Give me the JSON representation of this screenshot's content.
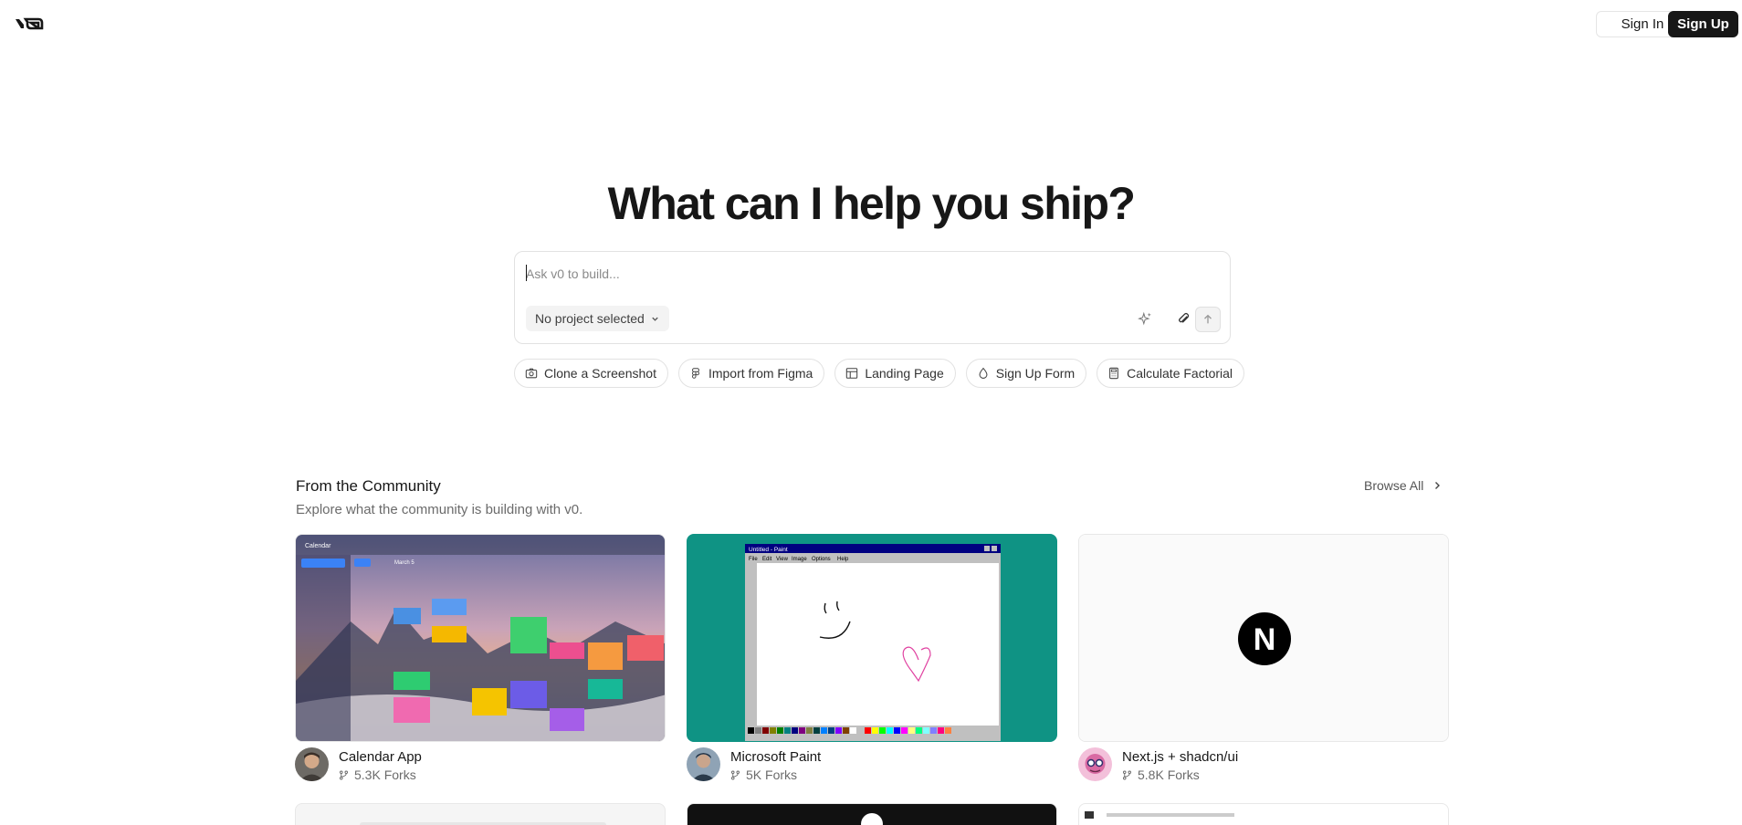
{
  "header": {
    "logo_icon": "v0-logo-icon",
    "signin_label": "Sign In",
    "signup_label": "Sign Up"
  },
  "hero": {
    "title": "What can I help you ship?"
  },
  "prompt": {
    "placeholder": "Ask v0 to build...",
    "project_select_label": "No project selected",
    "icons": [
      "sparkle-icon",
      "paperclip-icon",
      "arrow-up-icon"
    ]
  },
  "suggestions": [
    {
      "label": "Clone a Screenshot",
      "icon": "camera-icon"
    },
    {
      "label": "Import from Figma",
      "icon": "figma-icon"
    },
    {
      "label": "Landing Page",
      "icon": "layout-icon"
    },
    {
      "label": "Sign Up Form",
      "icon": "droplet-icon"
    },
    {
      "label": "Calculate Factorial",
      "icon": "calculator-icon"
    }
  ],
  "community": {
    "title": "From the Community",
    "subtitle": "Explore what the community is building with v0.",
    "browse_all_label": "Browse All",
    "cards": [
      {
        "title": "Calendar App",
        "forks": "5.3K Forks"
      },
      {
        "title": "Microsoft Paint",
        "forks": "5K Forks"
      },
      {
        "title": "Next.js + shadcn/ui",
        "forks": "5.8K Forks"
      }
    ],
    "paint_window_title": "Untitled - Paint",
    "paint_menu": [
      "File",
      "Edit",
      "View",
      "Image",
      "Options",
      "Help"
    ],
    "calendar_app_label": "Calendar",
    "calendar_month_label": "March 5",
    "nextjs_logo_letter": "N"
  },
  "colors": {
    "accent_dark": "#171717",
    "paint_bg": "#0f9384",
    "paint_titlebar": "#000080"
  }
}
